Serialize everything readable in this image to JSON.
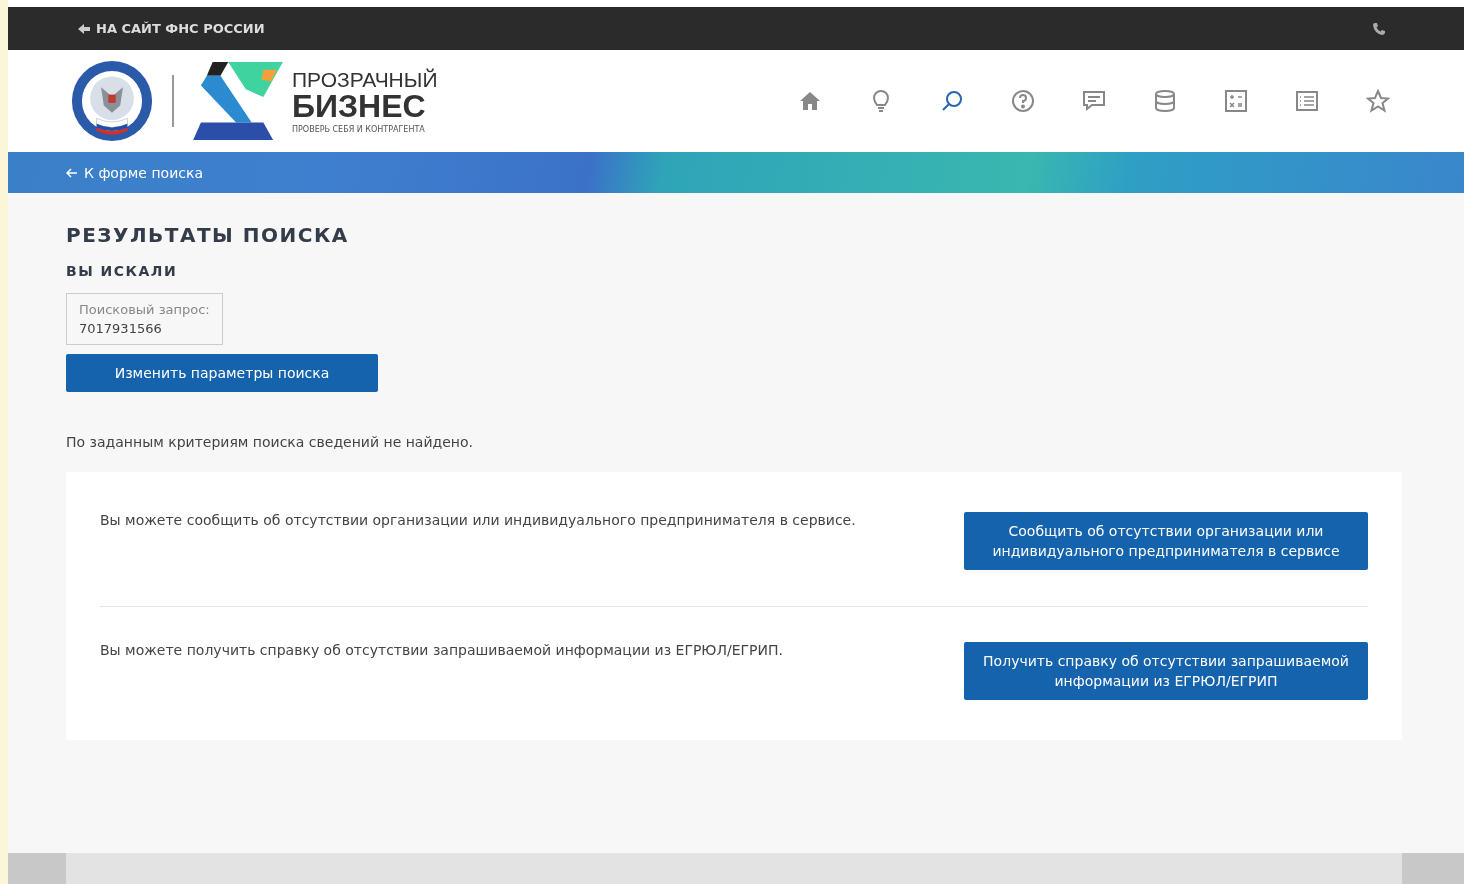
{
  "top_bar": {
    "back_link": "НА САЙТ ФНС РОССИИ"
  },
  "header": {
    "logo": {
      "line_1": "ПРОЗРАЧНЫЙ",
      "line_2": "БИЗНЕС",
      "tagline": "ПРОВЕРЬ СЕБЯ И КОНТРАГЕНТА"
    },
    "nav_icons": [
      {
        "kind": "home",
        "selected": false
      },
      {
        "kind": "bulb",
        "selected": false
      },
      {
        "kind": "search",
        "selected": true
      },
      {
        "kind": "help",
        "selected": false
      },
      {
        "kind": "chat",
        "selected": false
      },
      {
        "kind": "database",
        "selected": false
      },
      {
        "kind": "calculator",
        "selected": false
      },
      {
        "kind": "list",
        "selected": false
      },
      {
        "kind": "star",
        "selected": false
      }
    ]
  },
  "breadcrumb": {
    "back_link": "К форме поиска"
  },
  "results": {
    "title": "РЕЗУЛЬТАТЫ ПОИСКА",
    "subtitle": "ВЫ ИСКАЛИ",
    "query_label": "Поисковый запрос:",
    "query_value": "7017931566",
    "change_button": "Изменить параметры поиска",
    "not_found": "По заданным критериям поиска сведений не найдено."
  },
  "options": [
    {
      "text": "Вы можете сообщить об отсутствии организации или индивидуального предпринимателя в сервисе.",
      "button": "Сообщить об отсутствии организации или индивидуального предпринимателя в сервисе"
    },
    {
      "text": "Вы можете получить справку об отсутствии запрашиваемой информации из ЕГРЮЛ/ЕГРИП.",
      "button": "Получить справку об отсутствии запрашиваемой информации из ЕГРЮЛ/ЕГРИП"
    }
  ]
}
